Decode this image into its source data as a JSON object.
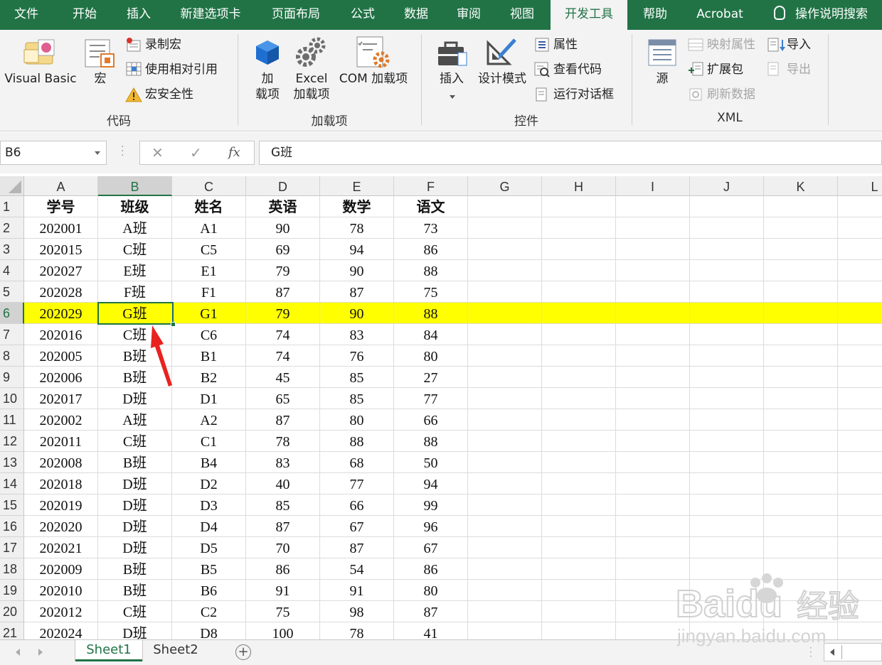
{
  "tabs": [
    {
      "label": "文件",
      "active": false
    },
    {
      "label": "开始",
      "active": false
    },
    {
      "label": "插入",
      "active": false
    },
    {
      "label": "新建选项卡",
      "active": false
    },
    {
      "label": "页面布局",
      "active": false
    },
    {
      "label": "公式",
      "active": false
    },
    {
      "label": "数据",
      "active": false
    },
    {
      "label": "审阅",
      "active": false
    },
    {
      "label": "视图",
      "active": false
    },
    {
      "label": "开发工具",
      "active": true
    },
    {
      "label": "帮助",
      "active": false
    },
    {
      "label": "Acrobat",
      "active": false
    }
  ],
  "tell_me": "操作说明搜索",
  "ribbon": {
    "code": {
      "label": "代码",
      "visual_basic": "Visual Basic",
      "macros": "宏",
      "record_macro": "录制宏",
      "relative_refs": "使用相对引用",
      "macro_security": "宏安全性"
    },
    "addins": {
      "label": "加载项",
      "addins_line1": "加",
      "addins_line2": "载项",
      "excel_addins_line1": "Excel",
      "excel_addins_line2": "加载项",
      "com_addins": "COM 加载项"
    },
    "controls": {
      "label": "控件",
      "insert": "插入",
      "design_mode": "设计模式",
      "properties": "属性",
      "view_code": "查看代码",
      "run_dialog": "运行对话框"
    },
    "xml": {
      "label": "XML",
      "source": "源",
      "map_properties": "映射属性",
      "expansion_packs": "扩展包",
      "refresh_data": "刷新数据",
      "import": "导入",
      "export": "导出"
    }
  },
  "formula_bar": {
    "name_box": "B6",
    "cancel": "✕",
    "enter": "✓",
    "fx": "fx",
    "content": "G班"
  },
  "columns": [
    "A",
    "B",
    "C",
    "D",
    "E",
    "F",
    "G",
    "H",
    "I",
    "J",
    "K",
    "L"
  ],
  "rows": [
    {
      "n": "1",
      "cells": [
        "学号",
        "班级",
        "姓名",
        "英语",
        "数学",
        "语文"
      ]
    },
    {
      "n": "2",
      "cells": [
        "202001",
        "A班",
        "A1",
        "90",
        "78",
        "73"
      ]
    },
    {
      "n": "3",
      "cells": [
        "202015",
        "C班",
        "C5",
        "69",
        "94",
        "86"
      ]
    },
    {
      "n": "4",
      "cells": [
        "202027",
        "E班",
        "E1",
        "79",
        "90",
        "88"
      ]
    },
    {
      "n": "5",
      "cells": [
        "202028",
        "F班",
        "F1",
        "87",
        "87",
        "75"
      ]
    },
    {
      "n": "6",
      "cells": [
        "202029",
        "G班",
        "G1",
        "79",
        "90",
        "88"
      ]
    },
    {
      "n": "7",
      "cells": [
        "202016",
        "C班",
        "C6",
        "74",
        "83",
        "84"
      ]
    },
    {
      "n": "8",
      "cells": [
        "202005",
        "B班",
        "B1",
        "74",
        "76",
        "80"
      ]
    },
    {
      "n": "9",
      "cells": [
        "202006",
        "B班",
        "B2",
        "45",
        "85",
        "27"
      ]
    },
    {
      "n": "10",
      "cells": [
        "202017",
        "D班",
        "D1",
        "65",
        "85",
        "77"
      ]
    },
    {
      "n": "11",
      "cells": [
        "202002",
        "A班",
        "A2",
        "87",
        "80",
        "66"
      ]
    },
    {
      "n": "12",
      "cells": [
        "202011",
        "C班",
        "C1",
        "78",
        "88",
        "88"
      ]
    },
    {
      "n": "13",
      "cells": [
        "202008",
        "B班",
        "B4",
        "83",
        "68",
        "50"
      ]
    },
    {
      "n": "14",
      "cells": [
        "202018",
        "D班",
        "D2",
        "40",
        "77",
        "94"
      ]
    },
    {
      "n": "15",
      "cells": [
        "202019",
        "D班",
        "D3",
        "85",
        "66",
        "99"
      ]
    },
    {
      "n": "16",
      "cells": [
        "202020",
        "D班",
        "D4",
        "87",
        "67",
        "96"
      ]
    },
    {
      "n": "17",
      "cells": [
        "202021",
        "D班",
        "D5",
        "70",
        "87",
        "67"
      ]
    },
    {
      "n": "18",
      "cells": [
        "202009",
        "B班",
        "B5",
        "86",
        "54",
        "86"
      ]
    },
    {
      "n": "19",
      "cells": [
        "202010",
        "B班",
        "B6",
        "91",
        "91",
        "80"
      ]
    },
    {
      "n": "20",
      "cells": [
        "202012",
        "C班",
        "C2",
        "75",
        "98",
        "87"
      ]
    },
    {
      "n": "21",
      "cells": [
        "202024",
        "D班",
        "D8",
        "100",
        "78",
        "41"
      ]
    }
  ],
  "selected_cell": "B6",
  "highlighted_row": "6",
  "sheets": [
    {
      "label": "Sheet1",
      "active": true
    },
    {
      "label": "Sheet2",
      "active": false
    }
  ],
  "watermark": {
    "brand": "Baidu",
    "cn": "经验",
    "url": "jingyan.baidu.com"
  },
  "colors": {
    "accent": "#217346",
    "highlight": "#ffff00",
    "annotation_arrow": "#e8231f"
  }
}
